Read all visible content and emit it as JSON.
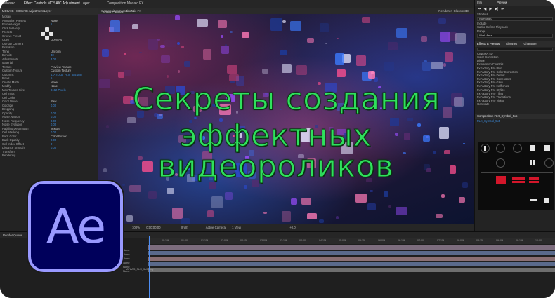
{
  "menu_tabs": [
    "Mosaic",
    "Effect Controls MOSAIC Adjustment Layer",
    "Composition Mosaic FX"
  ],
  "left_panel": {
    "header": "MOSAIC · MOSAIC Adjustment Layer",
    "rows": [
      {
        "label": "Mosaic",
        "value": ""
      },
      {
        "label": "Animation Presets",
        "value": "None"
      },
      {
        "label": "Frame Height",
        "value": "1"
      },
      {
        "label": "Click for Help",
        "value": ""
      },
      {
        "label": "Presets",
        "value": ""
      },
      {
        "label": "Groove Preset",
        "value": ""
      },
      {
        "label": "Open",
        "value": "Open As"
      },
      {
        "label": "Use 3D Camera",
        "value": ""
      },
      {
        "label": "Extrusion",
        "value": ""
      },
      {
        "label": "Tiling",
        "value": "Uniform"
      },
      {
        "label": "Density",
        "value": "30"
      },
      {
        "label": "Adjustments",
        "value": "3.00"
      },
      {
        "label": "Material",
        "value": ""
      },
      {
        "label": "Texture",
        "value": "Preview Texture"
      },
      {
        "label": "Custom Texture",
        "value": "Custom Texture"
      },
      {
        "label": "Columns",
        "value": "4. ATLAS_FLX_5x5.png"
      },
      {
        "label": "Rows",
        "value": "5"
      },
      {
        "label": "Create Matte",
        "value": "None"
      },
      {
        "label": "Modify",
        "value": "None"
      },
      {
        "label": "Max Texture Size",
        "value": "8192 Pixels"
      },
      {
        "label": "Cell Infos",
        "value": ""
      },
      {
        "label": "Cell Color",
        "value": ""
      },
      {
        "label": "Color Mode",
        "value": "Raw"
      },
      {
        "label": "Colorize",
        "value": "0.00"
      },
      {
        "label": "Dropping",
        "value": ""
      },
      {
        "label": "Opacity",
        "value": "0.00"
      },
      {
        "label": "Noise Amount",
        "value": "0.00"
      },
      {
        "label": "Noise Frequency",
        "value": "0.00"
      },
      {
        "label": "Noise Evolution",
        "value": "0.00"
      },
      {
        "label": "Padding Destination",
        "value": "Texture"
      },
      {
        "label": "Cell Masking",
        "value": "0.00"
      },
      {
        "label": "Back Color",
        "value": "Color Picker"
      },
      {
        "label": "Back Opacity",
        "value": "0.00"
      },
      {
        "label": "Cell Index Offset",
        "value": "0"
      },
      {
        "label": "Distance Smooth",
        "value": "0.00"
      },
      {
        "label": "Transform",
        "value": ""
      },
      {
        "label": "Rendering",
        "value": ""
      }
    ]
  },
  "viewer": {
    "tab": "Composition Mosaic FX",
    "layer_label": "Mosaic FX",
    "camera_label": "Active Camera",
    "right_label": "Renderer: Classic 3D"
  },
  "headline": {
    "line1": "Секреты создания",
    "line2": "эффектных видеороликов"
  },
  "viewer_toolbar": {
    "zoom": "100%",
    "time": "0;00;00;00",
    "resolution": "(Full)",
    "camera": "Active Camera",
    "view": "1 View",
    "offset": "+0.0",
    "custom": "(Custom..."
  },
  "right_panel": {
    "tabs": [
      "Info",
      "Preview"
    ],
    "shortcut_label": "Shortcut",
    "shortcut_value": "Numpad 0",
    "include_label": "Include",
    "cache_label": "Cache Before Playback",
    "range_label": "Range",
    "range_value": "Work Area",
    "effects_tabs": [
      "Effects & Presets",
      "Libraries",
      "Character"
    ],
    "effects": [
      "CINEMA 4D",
      "Color Correction",
      "Distort",
      "Expression Controls",
      "FxFactory Pro Blur",
      "FxFactory Pro Color Correction",
      "FxFactory Pro Distort",
      "FxFactory Pro Generators",
      "FxFactory Pro Glow",
      "FxFactory Pro Halftones",
      "FxFactory Pro Stylize",
      "FxFactory Pro Tiling",
      "FxFactory Pro Transitions",
      "FxFactory Pro Video",
      "Generate"
    ],
    "comp_tab": "Composition FLX_Symbol_5x5",
    "comp_sub": "FLX_Symbol_5x5"
  },
  "timeline": {
    "header": "Render Queue",
    "timecode": "0;00;00;00",
    "layer_modes": [
      "None",
      "None",
      "None",
      "None",
      "None",
      "None"
    ],
    "ruler_ticks": [
      "00:15f",
      "01:00f",
      "01:15f",
      "02:00f",
      "02:15f",
      "03:00f",
      "03:15f",
      "04:00f",
      "04:15f",
      "05:00f",
      "05:15f",
      "06:00f",
      "06:15f",
      "07:00f",
      "07:15f",
      "08:00f",
      "08:15f",
      "09:00f",
      "09:15f",
      "10:00f"
    ],
    "layer_name": "ATLAS_FLX_5x5.png"
  },
  "logo_text": "Ae",
  "colors": {
    "headline_green": "#2fe05d",
    "ae_bg": "#00005b",
    "ae_fg": "#9999ff",
    "accent_blue": "#3d8ee0"
  }
}
